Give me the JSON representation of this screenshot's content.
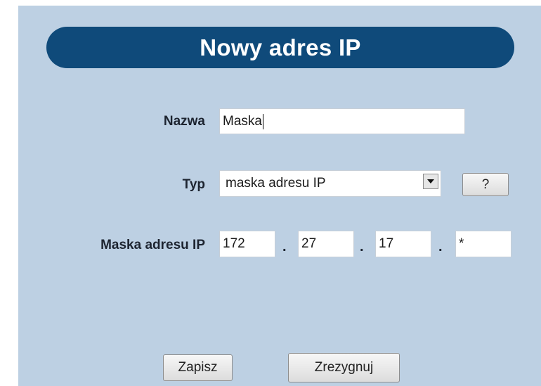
{
  "header": {
    "title": "Nowy adres IP"
  },
  "form": {
    "name_label": "Nazwa",
    "name_value": "Maska",
    "type_label": "Typ",
    "type_value": "maska adresu IP",
    "help_label": "?",
    "mask_label": "Maska adresu IP",
    "octets": [
      "172",
      "27",
      "17",
      "*"
    ],
    "separator": "."
  },
  "footer": {
    "save_label": "Zapisz",
    "cancel_label": "Zrezygnuj"
  },
  "colors": {
    "header_bar": "#0f4a7a",
    "panel_background": "#bdd0e3"
  },
  "icons": {
    "dropdown": "chevron-down-icon"
  }
}
